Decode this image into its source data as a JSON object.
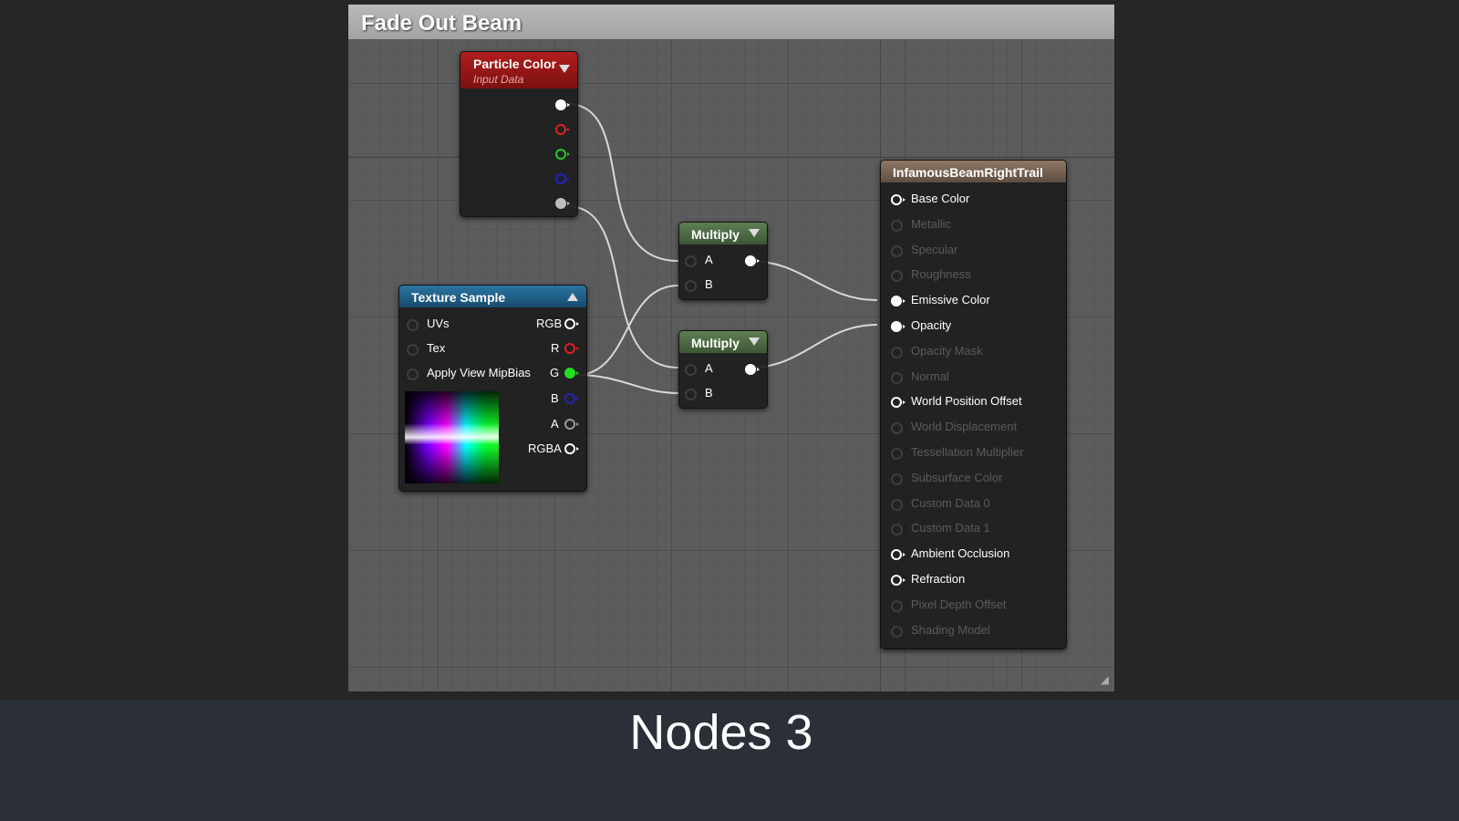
{
  "graph": {
    "title": "Fade Out Beam"
  },
  "nodes": {
    "particle_color": {
      "title": "Particle Color",
      "subtitle": "Input Data",
      "header_color": "#9e1a1a",
      "pins": [
        "white",
        "red",
        "green",
        "blue",
        "alpha"
      ]
    },
    "texture_sample": {
      "title": "Texture Sample",
      "header_color": "#1f5f86",
      "inputs": [
        "UVs",
        "Tex",
        "Apply View MipBias"
      ],
      "outputs": [
        "RGB",
        "R",
        "G",
        "B",
        "A",
        "RGBA"
      ]
    },
    "multiply_1": {
      "title": "Multiply",
      "input_a": "A",
      "input_b": "B",
      "header_color": "#4f6b46"
    },
    "multiply_2": {
      "title": "Multiply",
      "input_a": "A",
      "input_b": "B",
      "header_color": "#4f6b46"
    },
    "material": {
      "title": "InfamousBeamRightTrail",
      "header_color": "#7a6656",
      "inputs": [
        {
          "label": "Base Color",
          "active": true
        },
        {
          "label": "Metallic",
          "active": false
        },
        {
          "label": "Specular",
          "active": false
        },
        {
          "label": "Roughness",
          "active": false
        },
        {
          "label": "Emissive Color",
          "active": true
        },
        {
          "label": "Opacity",
          "active": true
        },
        {
          "label": "Opacity Mask",
          "active": false
        },
        {
          "label": "Normal",
          "active": false
        },
        {
          "label": "World Position Offset",
          "active": true
        },
        {
          "label": "World Displacement",
          "active": false
        },
        {
          "label": "Tessellation Multiplier",
          "active": false
        },
        {
          "label": "Subsurface Color",
          "active": false
        },
        {
          "label": "Custom Data 0",
          "active": false
        },
        {
          "label": "Custom Data 1",
          "active": false
        },
        {
          "label": "Ambient Occlusion",
          "active": true
        },
        {
          "label": "Refraction",
          "active": true
        },
        {
          "label": "Pixel Depth Offset",
          "active": false
        },
        {
          "label": "Shading Model",
          "active": false
        }
      ]
    }
  },
  "caption": "Nodes 3"
}
